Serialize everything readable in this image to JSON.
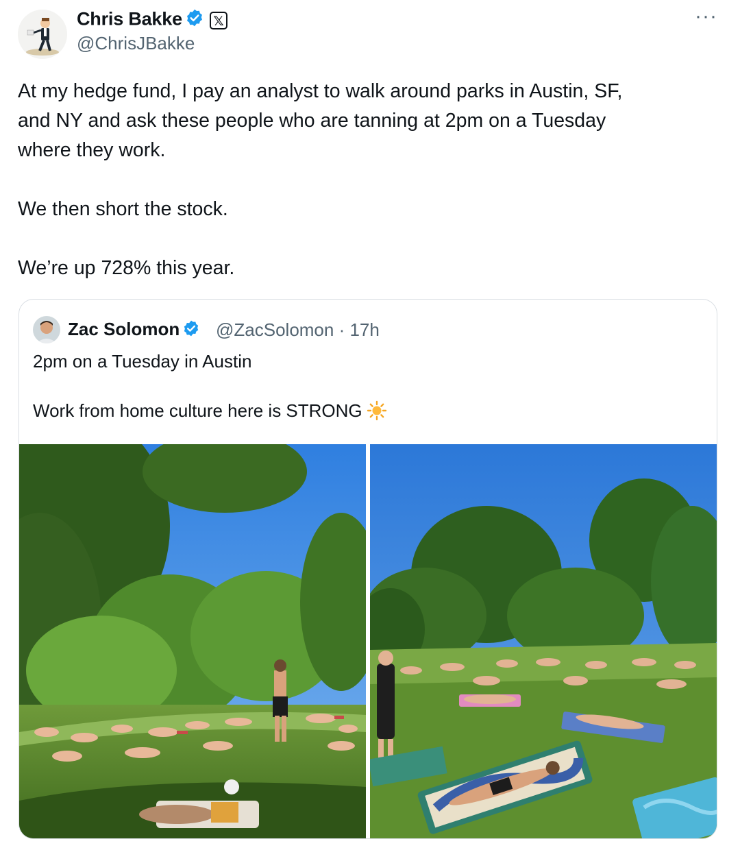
{
  "author": {
    "name": "Chris Bakke",
    "handle": "@ChrisJBakke",
    "badge_icon": "verified-badge-icon",
    "x_icon_text": "𝕏"
  },
  "menu": {
    "more_label": "···"
  },
  "tweet": {
    "lines": [
      "At my hedge fund, I pay an analyst to walk around parks in Austin, SF,",
      "and NY and ask these people who are tanning at 2pm on a Tuesday",
      "where they work."
    ],
    "line2": "We then short the stock.",
    "line3": "We’re up 728% this year."
  },
  "quoted": {
    "name": "Zac Solomon",
    "handle_time": "@ZacSolomon · 17h",
    "text1": "2pm on a Tuesday in Austin",
    "text2": "Work from home culture here is STRONG",
    "emoji_icon": "sun-icon"
  },
  "colors": {
    "verified": "#1d9bf0",
    "secondary_text": "#536471",
    "border": "#d8dde2"
  }
}
